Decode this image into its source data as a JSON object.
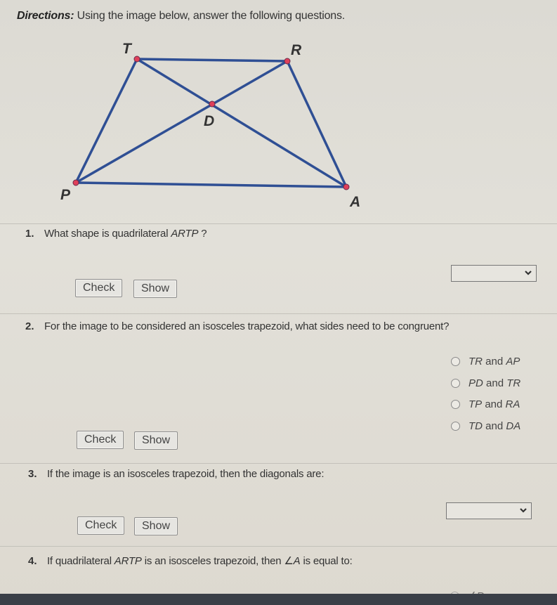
{
  "directions": {
    "label": "Directions:",
    "text": " Using the image below, answer the following questions."
  },
  "figure": {
    "vertices": {
      "T": "T",
      "R": "R",
      "D": "D",
      "P": "P",
      "A": "A"
    },
    "line_color": "#2f4f94",
    "point_color": "#e0405a"
  },
  "questions": [
    {
      "number": "1.",
      "text_before": "What shape is quadrilateral ",
      "text_italic": "ARTP",
      "text_after": " ?",
      "answer_type": "dropdown",
      "dropdown_value": "",
      "check_label": "Check",
      "show_label": "Show"
    },
    {
      "number": "2.",
      "text": "For the image to be considered an isosceles trapezoid, what sides need to be congruent?",
      "answer_type": "radio",
      "options": [
        {
          "a": "TR",
          "and": " and ",
          "b": "AP"
        },
        {
          "a": "PD",
          "and": " and ",
          "b": "TR"
        },
        {
          "a": "TP",
          "and": " and ",
          "b": "RA"
        },
        {
          "a": "TD",
          "and": " and ",
          "b": "DA"
        }
      ],
      "check_label": "Check",
      "show_label": "Show"
    },
    {
      "number": "3.",
      "text": "If the image is an isosceles trapezoid, then the diagonals are:",
      "answer_type": "dropdown",
      "dropdown_value": "",
      "check_label": "Check",
      "show_label": "Show"
    },
    {
      "number": "4.",
      "text_before": "If quadrilateral ",
      "text_italic": "ARTP",
      "text_mid": " is an isosceles trapezoid, then ",
      "angle_symbol": "∠",
      "angle_italic": "A",
      "text_after": " is equal to:",
      "answer_type": "radio",
      "options_partial": [
        {
          "label": "∠P"
        }
      ]
    }
  ]
}
